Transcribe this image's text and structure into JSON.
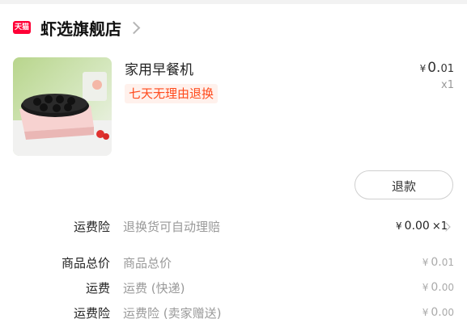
{
  "store": {
    "logo_text": "天猫",
    "name": "虾选旗舰店",
    "chevron_icon": "chevron-right-icon"
  },
  "product": {
    "title": "家用早餐机",
    "tag": "七天无理由退换",
    "price_currency": "¥",
    "price_int": "0.",
    "price_dec": "01",
    "quantity": "x1"
  },
  "actions": {
    "refund_label": "退款"
  },
  "insurance_row": {
    "label": "运费险",
    "desc": "退换货可自动理赔",
    "currency": "¥",
    "value": "0.00",
    "multiplier": "×1"
  },
  "summary": [
    {
      "label": "商品总价",
      "desc": "商品总价",
      "currency": "¥",
      "value_int": "0.",
      "value_dec": "01"
    },
    {
      "label": "运费",
      "desc": "运费 (快递)",
      "currency": "¥",
      "value_int": "0.",
      "value_dec": "00"
    },
    {
      "label": "运费险",
      "desc": "运费险 (卖家赠送)",
      "currency": "¥",
      "value_int": "0.",
      "value_dec": "00"
    }
  ],
  "colors": {
    "tmall_red": "#ff0036",
    "tag_orange": "#ff4a1c",
    "tag_bg": "#fff1ec"
  }
}
